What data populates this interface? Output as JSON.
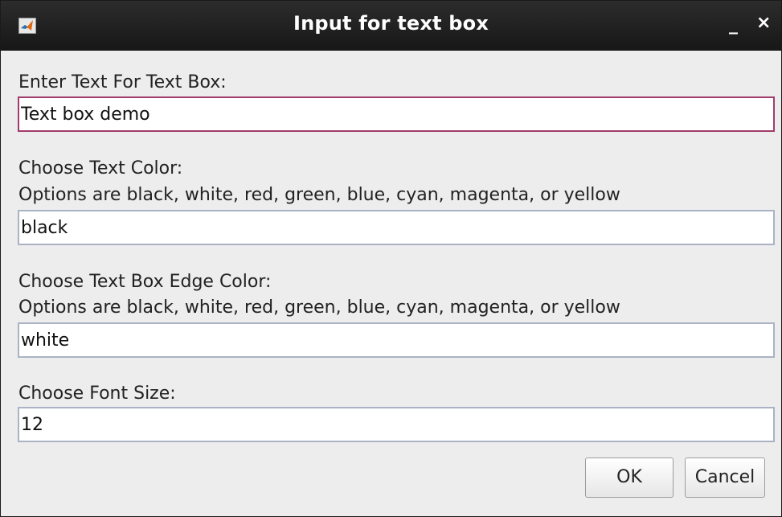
{
  "window": {
    "title": "Input for text box",
    "app_icon": "matlab-icon",
    "controls": {
      "minimize_label": "_",
      "close_label": "×"
    }
  },
  "form": {
    "text_label": "Enter Text For Text Box:",
    "text_value": "Text box demo",
    "color_label": "Choose Text Color:",
    "color_hint": "Options are black, white, red, green, blue, cyan, magenta, or yellow",
    "color_value": "black",
    "edge_label": "Choose Text Box Edge Color:",
    "edge_hint": "Options are black, white, red, green, blue, cyan, magenta, or yellow",
    "edge_value": "white",
    "font_size_label": "Choose Font Size:",
    "font_size_value": "12"
  },
  "buttons": {
    "ok_label": "OK",
    "cancel_label": "Cancel"
  },
  "colors": {
    "titlebar": "#1f1f1f",
    "focus_border": "#a03c6c",
    "field_border": "#aab2c4",
    "dialog_background": "#ededed"
  }
}
